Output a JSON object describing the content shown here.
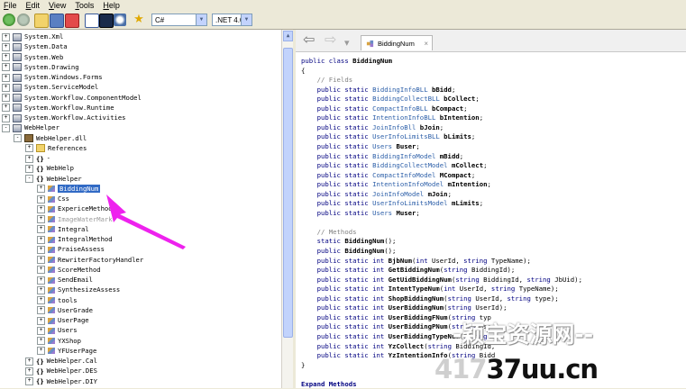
{
  "menu": [
    "File",
    "Edit",
    "View",
    "Tools",
    "Help"
  ],
  "toolbar": {
    "language": "C#",
    "framework": ".NET 4.0"
  },
  "tree": [
    {
      "text": "System.Xml",
      "indent": 0,
      "exp": "+",
      "icon": "assembly"
    },
    {
      "text": "System.Data",
      "indent": 0,
      "exp": "+",
      "icon": "assembly"
    },
    {
      "text": "System.Web",
      "indent": 0,
      "exp": "+",
      "icon": "assembly"
    },
    {
      "text": "System.Drawing",
      "indent": 0,
      "exp": "+",
      "icon": "assembly"
    },
    {
      "text": "System.Windows.Forms",
      "indent": 0,
      "exp": "+",
      "icon": "assembly"
    },
    {
      "text": "System.ServiceModel",
      "indent": 0,
      "exp": "+",
      "icon": "assembly"
    },
    {
      "text": "System.Workflow.ComponentModel",
      "indent": 0,
      "exp": "+",
      "icon": "assembly"
    },
    {
      "text": "System.Workflow.Runtime",
      "indent": 0,
      "exp": "+",
      "icon": "assembly"
    },
    {
      "text": "System.Workflow.Activities",
      "indent": 0,
      "exp": "+",
      "icon": "assembly"
    },
    {
      "text": "WebHelper",
      "indent": 0,
      "exp": "-",
      "icon": "assembly"
    },
    {
      "text": "WebHelper.dll",
      "indent": 1,
      "exp": "-",
      "icon": "dll"
    },
    {
      "text": "References",
      "indent": 2,
      "exp": "+",
      "icon": "folder"
    },
    {
      "text": "-",
      "indent": 2,
      "exp": "+",
      "icon": "namespace"
    },
    {
      "text": "WebHelp",
      "indent": 2,
      "exp": "+",
      "icon": "namespace"
    },
    {
      "text": "WebHelper",
      "indent": 2,
      "exp": "-",
      "icon": "namespace"
    },
    {
      "text": "BiddingNum",
      "indent": 3,
      "exp": "+",
      "icon": "class",
      "selected": true
    },
    {
      "text": "Css",
      "indent": 3,
      "exp": "+",
      "icon": "class"
    },
    {
      "text": "ExpericeMethod",
      "indent": 3,
      "exp": "+",
      "icon": "class"
    },
    {
      "text": "ImageWaterMark",
      "indent": 3,
      "exp": "+",
      "icon": "class",
      "gray": true
    },
    {
      "text": "Integral",
      "indent": 3,
      "exp": "+",
      "icon": "class"
    },
    {
      "text": "IntegralMethod",
      "indent": 3,
      "exp": "+",
      "icon": "class"
    },
    {
      "text": "PraiseAssess",
      "indent": 3,
      "exp": "+",
      "icon": "class"
    },
    {
      "text": "RewriterFactoryHandler",
      "indent": 3,
      "exp": "+",
      "icon": "class"
    },
    {
      "text": "ScoreMethod",
      "indent": 3,
      "exp": "+",
      "icon": "class"
    },
    {
      "text": "SendEmail",
      "indent": 3,
      "exp": "+",
      "icon": "class"
    },
    {
      "text": "SynthesizeAssess",
      "indent": 3,
      "exp": "+",
      "icon": "class"
    },
    {
      "text": "tools",
      "indent": 3,
      "exp": "+",
      "icon": "class"
    },
    {
      "text": "UserGrade",
      "indent": 3,
      "exp": "+",
      "icon": "class"
    },
    {
      "text": "UserPage",
      "indent": 3,
      "exp": "+",
      "icon": "class"
    },
    {
      "text": "Users",
      "indent": 3,
      "exp": "+",
      "icon": "class"
    },
    {
      "text": "YXShop",
      "indent": 3,
      "exp": "+",
      "icon": "class"
    },
    {
      "text": "YFUserPage",
      "indent": 3,
      "exp": "+",
      "icon": "class"
    },
    {
      "text": "WebHelper.Cal",
      "indent": 2,
      "exp": "+",
      "icon": "namespace"
    },
    {
      "text": "WebHelper.DES",
      "indent": 2,
      "exp": "+",
      "icon": "namespace"
    },
    {
      "text": "WebHelper.DIY",
      "indent": 2,
      "exp": "+",
      "icon": "namespace"
    }
  ],
  "tab": {
    "label": "BiddingNum",
    "close": "×"
  },
  "code": [
    {
      "parts": [
        [
          "kw",
          "public class "
        ],
        [
          "b",
          "BiddingNum"
        ]
      ]
    },
    {
      "parts": [
        [
          "",
          "{"
        ]
      ]
    },
    {
      "parts": [
        [
          "cm",
          "    // Fields"
        ]
      ]
    },
    {
      "parts": [
        [
          "kw",
          "    public static "
        ],
        [
          "ty",
          "BiddingInfoBLL "
        ],
        [
          "b",
          "bBidd"
        ],
        [
          "",
          ";"
        ]
      ]
    },
    {
      "parts": [
        [
          "kw",
          "    public static "
        ],
        [
          "ty",
          "BiddingCollectBLL "
        ],
        [
          "b",
          "bCollect"
        ],
        [
          "",
          ";"
        ]
      ]
    },
    {
      "parts": [
        [
          "kw",
          "    public static "
        ],
        [
          "ty",
          "CompactInfoBLL "
        ],
        [
          "b",
          "bCompact"
        ],
        [
          "",
          ";"
        ]
      ]
    },
    {
      "parts": [
        [
          "kw",
          "    public static "
        ],
        [
          "ty",
          "IntentionInfoBLL "
        ],
        [
          "b",
          "bIntention"
        ],
        [
          "",
          ";"
        ]
      ]
    },
    {
      "parts": [
        [
          "kw",
          "    public static "
        ],
        [
          "ty",
          "JoinInfoBll "
        ],
        [
          "b",
          "bJoin"
        ],
        [
          "",
          ";"
        ]
      ]
    },
    {
      "parts": [
        [
          "kw",
          "    public static "
        ],
        [
          "ty",
          "UserInfoLimitsBLL "
        ],
        [
          "b",
          "bLimits"
        ],
        [
          "",
          ";"
        ]
      ]
    },
    {
      "parts": [
        [
          "kw",
          "    public static "
        ],
        [
          "ty",
          "Users "
        ],
        [
          "b",
          "Buser"
        ],
        [
          "",
          ";"
        ]
      ]
    },
    {
      "parts": [
        [
          "kw",
          "    public static "
        ],
        [
          "ty",
          "BiddingInfoModel "
        ],
        [
          "b",
          "mBidd"
        ],
        [
          "",
          ";"
        ]
      ]
    },
    {
      "parts": [
        [
          "kw",
          "    public static "
        ],
        [
          "ty",
          "BiddingCollectModel "
        ],
        [
          "b",
          "mCollect"
        ],
        [
          "",
          ";"
        ]
      ]
    },
    {
      "parts": [
        [
          "kw",
          "    public static "
        ],
        [
          "ty",
          "CompactInfoModel "
        ],
        [
          "b",
          "MCompact"
        ],
        [
          "",
          ";"
        ]
      ]
    },
    {
      "parts": [
        [
          "kw",
          "    public static "
        ],
        [
          "ty",
          "IntentionInfoModel "
        ],
        [
          "b",
          "mIntention"
        ],
        [
          "",
          ";"
        ]
      ]
    },
    {
      "parts": [
        [
          "kw",
          "    public static "
        ],
        [
          "ty",
          "JoinInfoModel "
        ],
        [
          "b",
          "mJoin"
        ],
        [
          "",
          ";"
        ]
      ]
    },
    {
      "parts": [
        [
          "kw",
          "    public static "
        ],
        [
          "ty",
          "UserInfoLimitsModel "
        ],
        [
          "b",
          "mLimits"
        ],
        [
          "",
          ";"
        ]
      ]
    },
    {
      "parts": [
        [
          "kw",
          "    public static "
        ],
        [
          "ty",
          "Users "
        ],
        [
          "b",
          "Muser"
        ],
        [
          "",
          ";"
        ]
      ]
    },
    {
      "parts": [
        [
          "",
          ""
        ]
      ]
    },
    {
      "parts": [
        [
          "cm",
          "    // Methods"
        ]
      ]
    },
    {
      "parts": [
        [
          "kw",
          "    static "
        ],
        [
          "b",
          "BiddingNum"
        ],
        [
          "",
          "();"
        ]
      ]
    },
    {
      "parts": [
        [
          "kw",
          "    public "
        ],
        [
          "b",
          "BiddingNum"
        ],
        [
          "",
          "();"
        ]
      ]
    },
    {
      "parts": [
        [
          "kw",
          "    public static int "
        ],
        [
          "b",
          "BjbNum"
        ],
        [
          "",
          "("
        ],
        [
          "kw",
          "int "
        ],
        [
          "",
          "UserId, "
        ],
        [
          "kw",
          "string "
        ],
        [
          "",
          "TypeName);"
        ]
      ]
    },
    {
      "parts": [
        [
          "kw",
          "    public static int "
        ],
        [
          "b",
          "GetBiddingNum"
        ],
        [
          "",
          "("
        ],
        [
          "kw",
          "string "
        ],
        [
          "",
          "BiddingId);"
        ]
      ]
    },
    {
      "parts": [
        [
          "kw",
          "    public static int "
        ],
        [
          "b",
          "GetUidBiddingNum"
        ],
        [
          "",
          "("
        ],
        [
          "kw",
          "string "
        ],
        [
          "",
          "BiddingId, "
        ],
        [
          "kw",
          "string "
        ],
        [
          "",
          "JbUid);"
        ]
      ]
    },
    {
      "parts": [
        [
          "kw",
          "    public static int "
        ],
        [
          "b",
          "IntentTypeNum"
        ],
        [
          "",
          "("
        ],
        [
          "kw",
          "int "
        ],
        [
          "",
          "UserId, "
        ],
        [
          "kw",
          "string "
        ],
        [
          "",
          "TypeName);"
        ]
      ]
    },
    {
      "parts": [
        [
          "kw",
          "    public static int "
        ],
        [
          "b",
          "ShopBiddingNum"
        ],
        [
          "",
          "("
        ],
        [
          "kw",
          "string "
        ],
        [
          "",
          "UserId, "
        ],
        [
          "kw",
          "string "
        ],
        [
          "",
          "type);"
        ]
      ]
    },
    {
      "parts": [
        [
          "kw",
          "    public static int "
        ],
        [
          "b",
          "UserBiddingNum"
        ],
        [
          "",
          "("
        ],
        [
          "kw",
          "string "
        ],
        [
          "",
          "UserId);"
        ]
      ]
    },
    {
      "parts": [
        [
          "kw",
          "    public static int "
        ],
        [
          "b",
          "UserBiddingFNum"
        ],
        [
          "",
          "("
        ],
        [
          "kw",
          "string "
        ],
        [
          "",
          "typ"
        ]
      ]
    },
    {
      "parts": [
        [
          "kw",
          "    public static int "
        ],
        [
          "b",
          "UserBiddingPNum"
        ],
        [
          "",
          "("
        ],
        [
          "kw",
          "string "
        ],
        [
          "",
          "Use"
        ]
      ]
    },
    {
      "parts": [
        [
          "kw",
          "    public static int "
        ],
        [
          "b",
          "UserBiddingTypeNum"
        ],
        [
          "",
          "("
        ],
        [
          "kw",
          "string"
        ]
      ]
    },
    {
      "parts": [
        [
          "kw",
          "    public static int "
        ],
        [
          "b",
          "YzCollect"
        ],
        [
          "",
          "("
        ],
        [
          "kw",
          "string "
        ],
        [
          "",
          "BiddingId, "
        ]
      ]
    },
    {
      "parts": [
        [
          "kw",
          "    public static int "
        ],
        [
          "b",
          "YzIntentionInfo"
        ],
        [
          "",
          "("
        ],
        [
          "kw",
          "string "
        ],
        [
          "",
          "Bidd"
        ]
      ]
    },
    {
      "parts": [
        [
          "",
          "}"
        ]
      ]
    },
    {
      "parts": [
        [
          "",
          ""
        ]
      ]
    },
    {
      "parts": [
        [
          "b kw",
          "Expand Methods"
        ]
      ]
    }
  ],
  "watermark": {
    "line1": "-颖宝资源网--",
    "line2_gray": "417",
    "line2_black": "37uu.cn"
  },
  "colors": {
    "arrow": "#ee22ee",
    "selection": "#316ac5",
    "keyword": "#000080",
    "type": "#2b5ea8"
  }
}
